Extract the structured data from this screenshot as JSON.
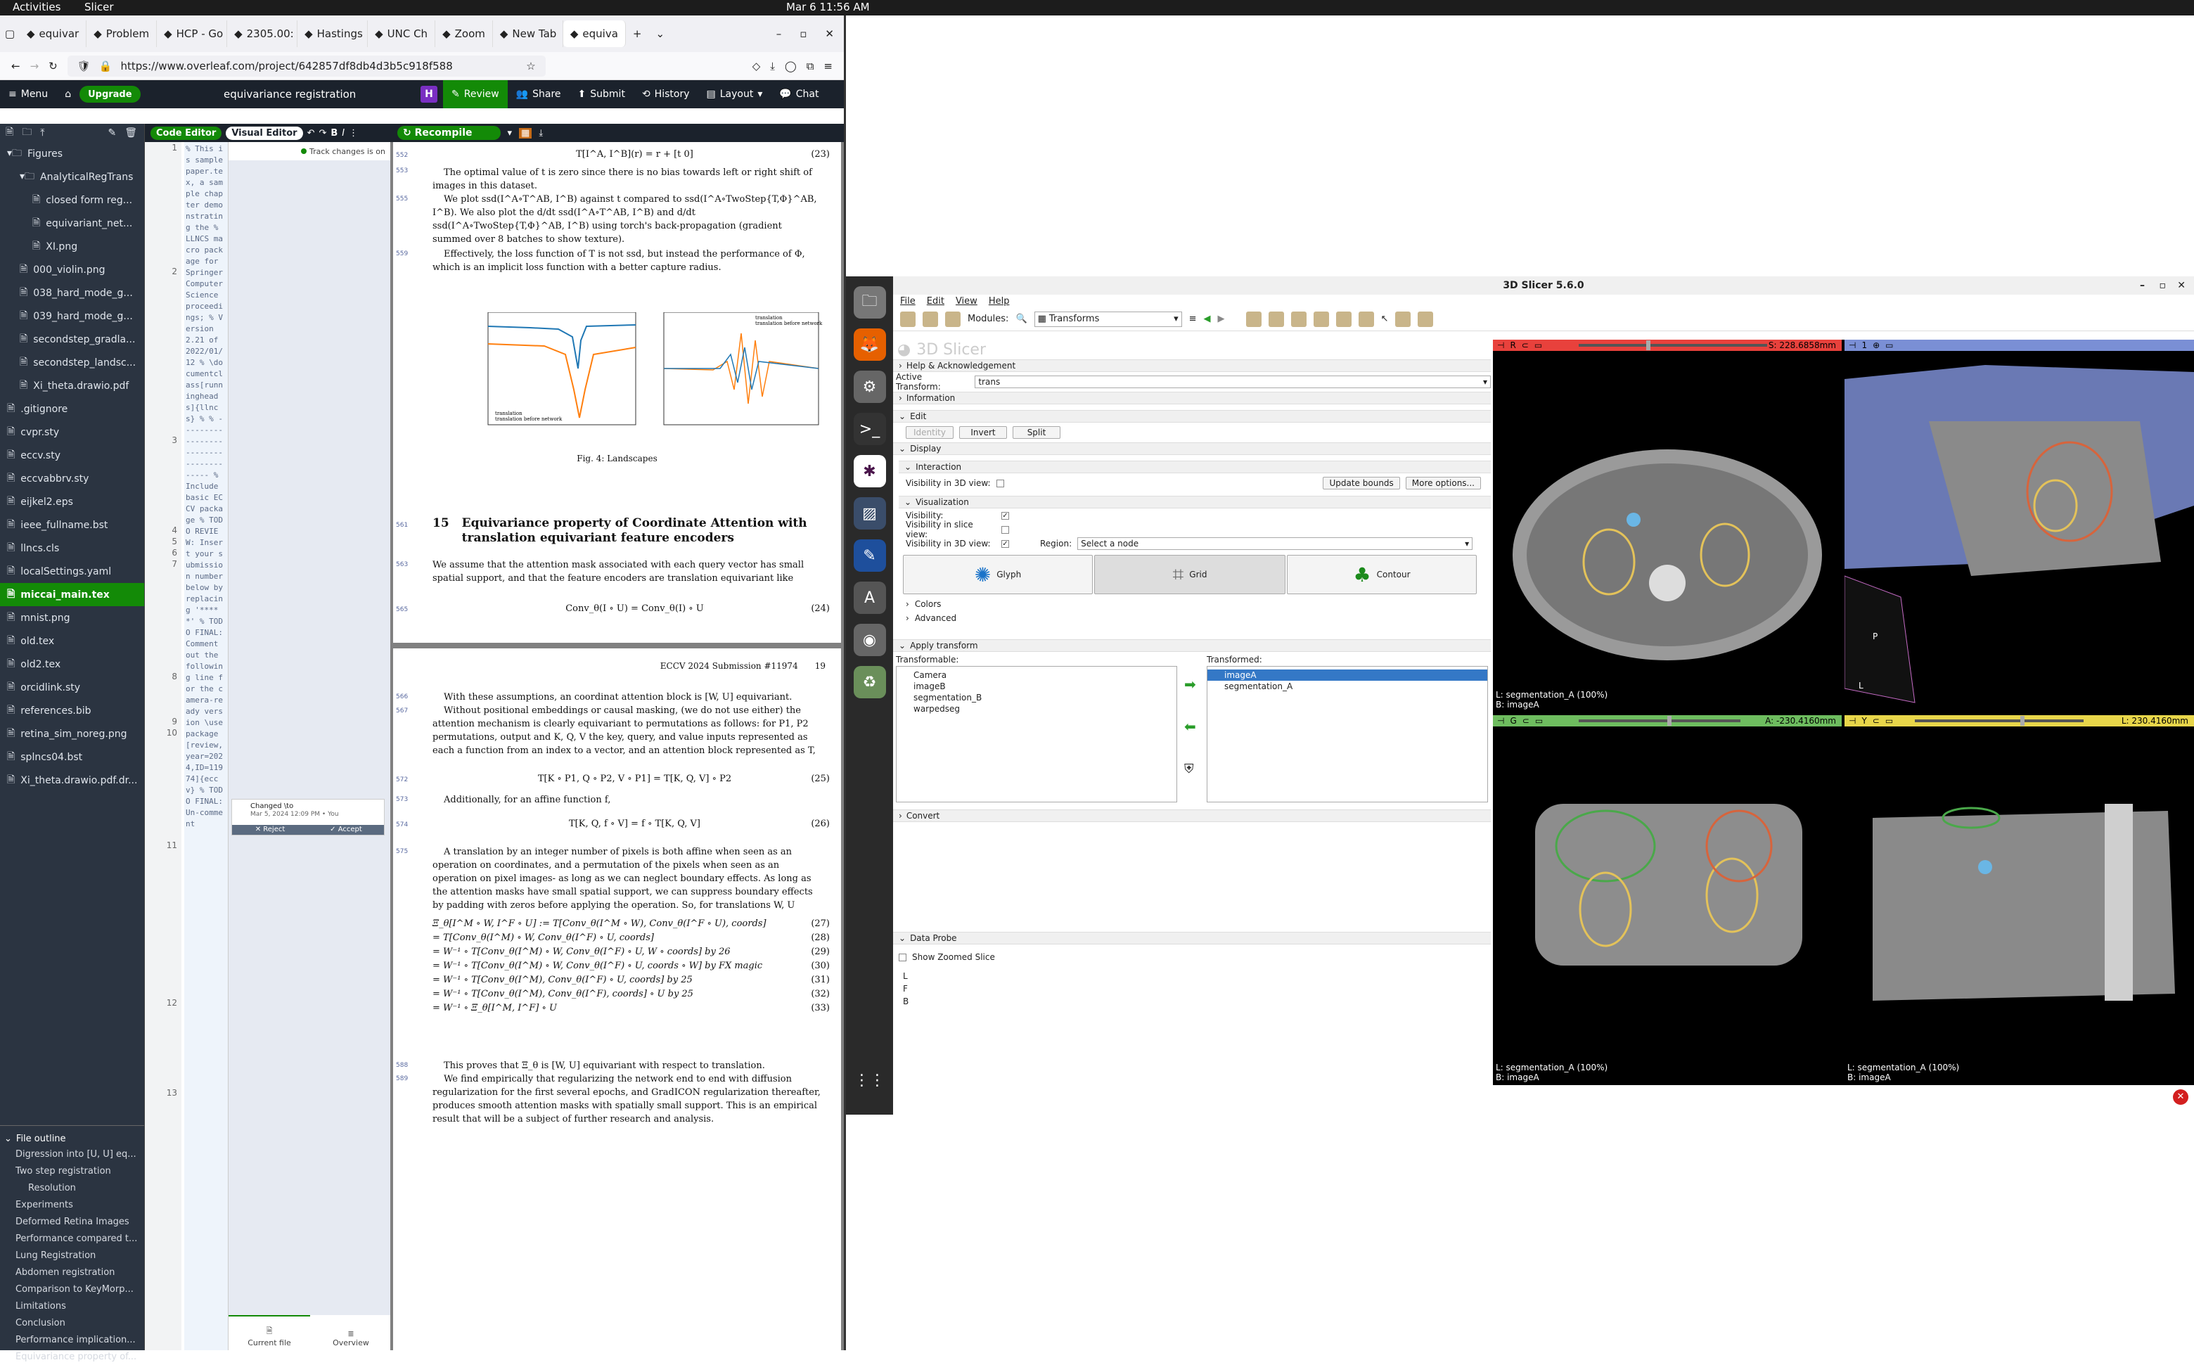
{
  "system": {
    "activities": "Activities",
    "app": "Slicer",
    "clock": "Mar 6  11:56 AM"
  },
  "browser": {
    "tabs": [
      "equivar",
      "Problem",
      "HCP - Go",
      "2305.00:",
      "Hastings",
      "UNC Ch",
      "Zoom",
      "New Tab",
      "equiva"
    ],
    "url": "https://www.overleaf.com/project/642857df8db4d3b5c918f588"
  },
  "overleaf": {
    "menu": "Menu",
    "upgrade": "Upgrade",
    "project_title": "equivariance registration",
    "review": "Review",
    "share": "Share",
    "submit": "Submit",
    "history": "History",
    "layout": "Layout",
    "chat": "Chat",
    "code_editor": "Code Editor",
    "visual_editor": "Visual Editor",
    "recompile": "Recompile",
    "h_badge": "H",
    "files": [
      {
        "name": "Figures",
        "indent": 0,
        "kind": "folder"
      },
      {
        "name": "AnalyticalRegTrans",
        "indent": 1,
        "kind": "folder"
      },
      {
        "name": "closed form reg...",
        "indent": 2,
        "kind": "file"
      },
      {
        "name": "equivariant_net...",
        "indent": 2,
        "kind": "file"
      },
      {
        "name": "XI.png",
        "indent": 2,
        "kind": "file"
      },
      {
        "name": "000_violin.png",
        "indent": 1,
        "kind": "file"
      },
      {
        "name": "038_hard_mode_g...",
        "indent": 1,
        "kind": "file"
      },
      {
        "name": "039_hard_mode_g...",
        "indent": 1,
        "kind": "file"
      },
      {
        "name": "secondstep_gradla...",
        "indent": 1,
        "kind": "file"
      },
      {
        "name": "secondstep_landsc...",
        "indent": 1,
        "kind": "file"
      },
      {
        "name": "Xi_theta.drawio.pdf",
        "indent": 1,
        "kind": "file"
      },
      {
        "name": ".gitignore",
        "indent": 0,
        "kind": "file"
      },
      {
        "name": "cvpr.sty",
        "indent": 0,
        "kind": "file"
      },
      {
        "name": "eccv.sty",
        "indent": 0,
        "kind": "file"
      },
      {
        "name": "eccvabbrv.sty",
        "indent": 0,
        "kind": "file"
      },
      {
        "name": "eijkel2.eps",
        "indent": 0,
        "kind": "file"
      },
      {
        "name": "ieee_fullname.bst",
        "indent": 0,
        "kind": "file"
      },
      {
        "name": "llncs.cls",
        "indent": 0,
        "kind": "file"
      },
      {
        "name": "localSettings.yaml",
        "indent": 0,
        "kind": "file"
      },
      {
        "name": "miccai_main.tex",
        "indent": 0,
        "kind": "file",
        "selected": true
      },
      {
        "name": "mnist.png",
        "indent": 0,
        "kind": "file"
      },
      {
        "name": "old.tex",
        "indent": 0,
        "kind": "file"
      },
      {
        "name": "old2.tex",
        "indent": 0,
        "kind": "file"
      },
      {
        "name": "orcidlink.sty",
        "indent": 0,
        "kind": "file"
      },
      {
        "name": "references.bib",
        "indent": 0,
        "kind": "file"
      },
      {
        "name": "retina_sim_noreg.png",
        "indent": 0,
        "kind": "file"
      },
      {
        "name": "splncs04.bst",
        "indent": 0,
        "kind": "file"
      },
      {
        "name": "Xi_theta.drawio.pdf.dr...",
        "indent": 0,
        "kind": "file"
      }
    ],
    "outline_title": "File outline",
    "outline": [
      "Digression into [U, U] eq...",
      "Two step registration",
      "Resolution",
      "Experiments",
      "Deformed Retina Images",
      "Performance compared t...",
      "Lung Registration",
      "Abdomen registration",
      "Comparison to KeyMorp...",
      "Limitations",
      "Conclusion",
      "Performance implication...",
      "Equivariance property of..."
    ],
    "code_lines": [
      "1",
      "",
      "",
      "",
      "",
      "",
      "",
      "",
      "",
      "",
      "",
      "2",
      "",
      "",
      "",
      "",
      "",
      "",
      "",
      "",
      "",
      "",
      "",
      "",
      "",
      "",
      "3",
      "",
      "",
      "",
      "",
      "",
      "",
      "",
      "4",
      "5",
      "6",
      "7",
      "",
      "",
      "",
      "",
      "",
      "",
      "",
      "",
      "",
      "8",
      "",
      "",
      "",
      "9",
      "10",
      "",
      "",
      "",
      "",
      "",
      "",
      "",
      "",
      "",
      "11",
      "",
      "",
      "",
      "",
      "",
      "",
      "",
      "",
      "",
      "",
      "",
      "",
      "",
      "12",
      "",
      "",
      "",
      "",
      "",
      "",
      "",
      "13",
      "",
      "",
      ""
    ],
    "code_text": "% This is samplepaper.tex, a sample chapter demonstrating the % LLNCS macro package for Springer Computer Science proceedings; % Version 2.21 of 2022/01/12 % \\documentclass[runningheads]{llncs} % % -------------------------------------- % Include basic ECCV package % TODO REVIEW: Insert your submission number below by replacing '*****' % TODO FINAL: Comment out the following line for the camera-ready version \\usepackage[review,year=2024,ID=11974]{eccv} % TODO FINAL: Un-comment",
    "track_changes": "Track changes is on",
    "change_card": {
      "title": "Changed \\to",
      "date": "Mar 5, 2024 12:09 PM",
      "by": "You",
      "reject": "Reject",
      "accept": "Accept"
    },
    "review_tabs": {
      "current": "Current file",
      "overview": "Overview"
    },
    "pdf": {
      "eq23": "T[I^A, I^B](r) = r + [t 0]",
      "eq23n": "(23)",
      "p1": "The optimal value of t is zero since there is no bias towards left or right shift of images in this dataset.",
      "p2": "We plot ssd(I^A∘T^AB, I^B) against t compared to ssd(I^A∘TwoStep{T,Φ}^AB, I^B). We also plot the d/dt ssd(I^A∘T^AB, I^B) and d/dt ssd(I^A∘TwoStep{T,Φ}^AB, I^B) using torch's back-propagation (gradient summed over 8 batches to show texture).",
      "p3": "Effectively, the loss function of T is not ssd, but instead the performance of Φ, which is an implicit loss function with a better capture radius.",
      "fig_caption": "Fig. 4: Landscapes",
      "legend1a": "translation",
      "legend1b": "translation before network",
      "sec_num": "15",
      "sec_title": "Equivariance property of Coordinate Attention with translation equivariant feature encoders",
      "p4": "We assume that the attention mask associated with each query vector has small spatial support, and that the feature encoders are translation equivariant like",
      "eq24": "Conv_θ(I ∘ U) = Conv_θ(I) ∘ U",
      "eq24n": "(24)",
      "header": "ECCV 2024 Submission #11974",
      "pagenum": "19",
      "p5": "With these assumptions, an coordinat attention block is [W, U] equivariant.",
      "p6": "Without positional embeddings or causal masking, (we do not use either) the attention mechanism is clearly equivariant to permutations as follows: for P1, P2 permutations, output and K, Q, V the key, query, and value inputs represented as each a function from an index to a vector, and an attention block represented as T,",
      "eq25": "T[K ∘ P1, Q ∘ P2, V ∘ P1] = T[K, Q, V] ∘ P2",
      "eq25n": "(25)",
      "p7": "Additionally, for an affine function f,",
      "eq26": "T[K, Q, f ∘ V] = f ∘ T[K, Q, V]",
      "eq26n": "(26)",
      "p8": "A translation by an integer number of pixels is both affine when seen as an operation on coordinates, and a permutation of the pixels when seen as an operation on pixel images- as long as we can neglect boundary effects. As long as the attention masks have small spatial support, we can suppress boundary effects by padding with zeros before applying the operation. So, for translations W, U",
      "eqs": [
        {
          "t": "Ξ_θ[I^M ∘ W, I^F ∘ U] := T[Conv_θ(I^M ∘ W), Conv_θ(I^F ∘ U), coords]",
          "n": "(27)"
        },
        {
          "t": "= T[Conv_θ(I^M) ∘ W, Conv_θ(I^F) ∘ U, coords]",
          "n": "(28)"
        },
        {
          "t": "= W⁻¹ ∘ T[Conv_θ(I^M) ∘ W, Conv_θ(I^F) ∘ U, W ∘ coords] by 26",
          "n": "(29)"
        },
        {
          "t": "= W⁻¹ ∘ T[Conv_θ(I^M) ∘ W, Conv_θ(I^F) ∘ U, coords ∘ W] by FX magic",
          "n": "(30)"
        },
        {
          "t": "= W⁻¹ ∘ T[Conv_θ(I^M), Conv_θ(I^F) ∘ U, coords] by 25",
          "n": "(31)"
        },
        {
          "t": "= W⁻¹ ∘ T[Conv_θ(I^M), Conv_θ(I^F), coords] ∘ U by 25",
          "n": "(32)"
        },
        {
          "t": "= W⁻¹ ∘ Ξ_θ[I^M, I^F] ∘ U",
          "n": "(33)"
        }
      ],
      "p9": "This proves that Ξ_θ is [W, U] equivariant with respect to translation.",
      "p10": "We find empirically that regularizing the network end to end with diffusion regularization for the first several epochs, and GradICON regularization thereafter, produces smooth attention masks with spatially small support. This is an empirical result that will be a subject of further research and analysis."
    }
  },
  "slicer": {
    "title": "3D Slicer 5.6.0",
    "menu": [
      "File",
      "Edit",
      "View",
      "Help"
    ],
    "modules_label": "Modules:",
    "module": "Transforms",
    "logo": "3D Slicer",
    "help": "Help & Acknowledgement",
    "active_transform_label": "Active Transform:",
    "active_transform": "trans",
    "information": "Information",
    "edit": "Edit",
    "edit_buttons": [
      "Identity",
      "Invert",
      "Split"
    ],
    "display": "Display",
    "interaction": "Interaction",
    "vis3d": "Visibility in 3D view:",
    "update_bounds": "Update bounds",
    "more_options": "More options...",
    "visualization": "Visualization",
    "visibility": "Visibility:",
    "vis_slice": "Visibility in slice view:",
    "region_label": "Region:",
    "region": "Select a node",
    "glyph": "Glyph",
    "grid": "Grid",
    "contour": "Contour",
    "colors": "Colors",
    "advanced": "Advanced",
    "apply_transform": "Apply transform",
    "transformable_label": "Transformable:",
    "transformable": [
      "Camera",
      "imageB",
      "segmentation_B",
      "warpedseg"
    ],
    "transformed_label": "Transformed:",
    "transformed": [
      "imageA",
      "segmentation_A"
    ],
    "convert": "Convert",
    "data_probe": "Data Probe",
    "show_zoomed": "Show Zoomed Slice",
    "probe_rows": [
      "L",
      "F",
      "B"
    ],
    "views": {
      "red": {
        "label": "R",
        "value": "S: 228.6858mm",
        "l1": "L: segmentation_A (100%)",
        "l2": "B: imageA"
      },
      "green": {
        "label": "G",
        "value": "A: -230.4160mm",
        "l1": "L: segmentation_A (100%)",
        "l2": "B: imageA"
      },
      "yellow": {
        "label": "Y",
        "value": "L: 230.4160mm",
        "l1": "L: segmentation_A (100%)",
        "l2": "B: imageA"
      },
      "threed": {
        "label": "1",
        "p": "P",
        "l": "L"
      }
    }
  }
}
